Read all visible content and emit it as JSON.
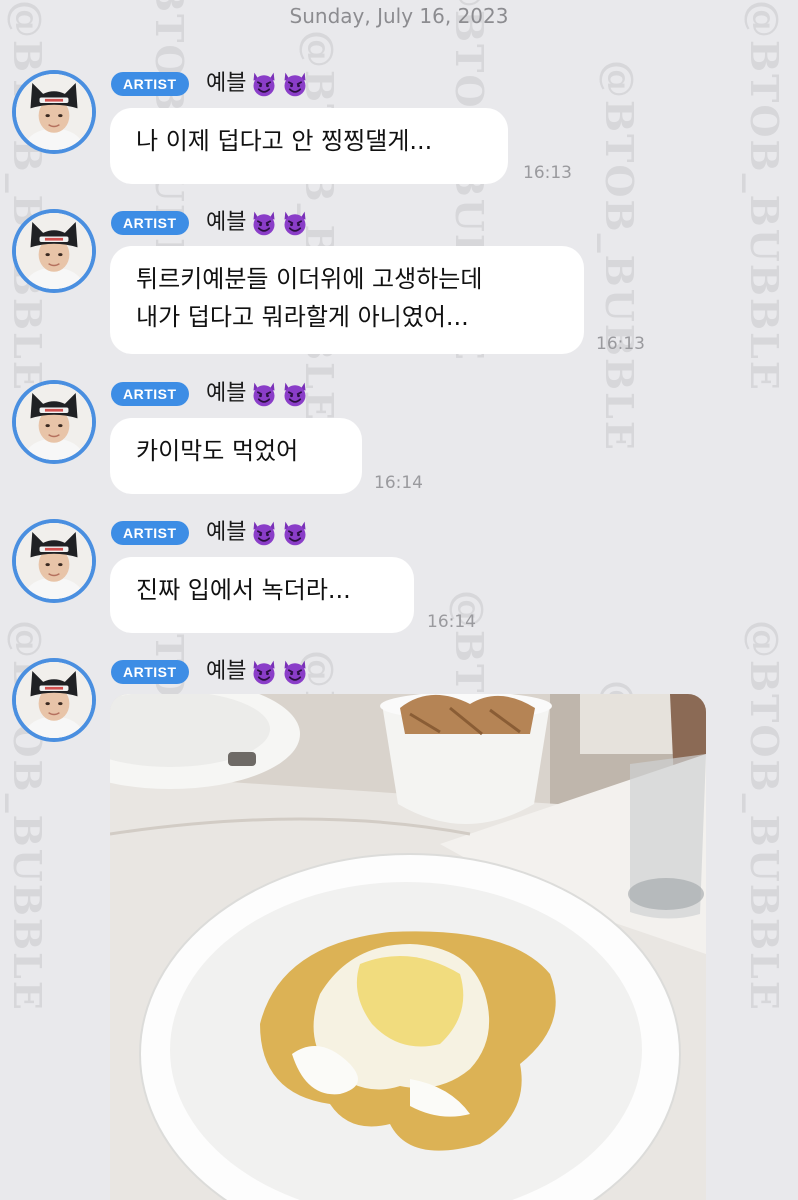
{
  "watermark": "@BTOB_BUBBLE",
  "date_header": "Sunday, July 16, 2023",
  "messages": [
    {
      "badge": "ARTIST",
      "name": "예블",
      "text": "나 이제 덥다고 안 찡찡댈게...",
      "time": "16:13"
    },
    {
      "badge": "ARTIST",
      "name": "예블",
      "text": "튀르키예분들 이더위에 고생하는데\n내가 덥다고 뭐라할게 아니였어...",
      "time": "16:13"
    },
    {
      "badge": "ARTIST",
      "name": "예블",
      "text": "카이막도 먹었어",
      "time": "16:14"
    },
    {
      "badge": "ARTIST",
      "name": "예블",
      "text": "진짜 입에서 녹더라...",
      "time": "16:14"
    },
    {
      "badge": "ARTIST",
      "name": "예블"
    }
  ],
  "emoji": [
    "smiling-devil-icon",
    "smiling-devil-icon"
  ],
  "colors": {
    "background": "#e9e9ec",
    "badge": "#3d8de5",
    "avatar_ring": "#4a8fe0",
    "emoji_purple": "#8a3dc8"
  }
}
